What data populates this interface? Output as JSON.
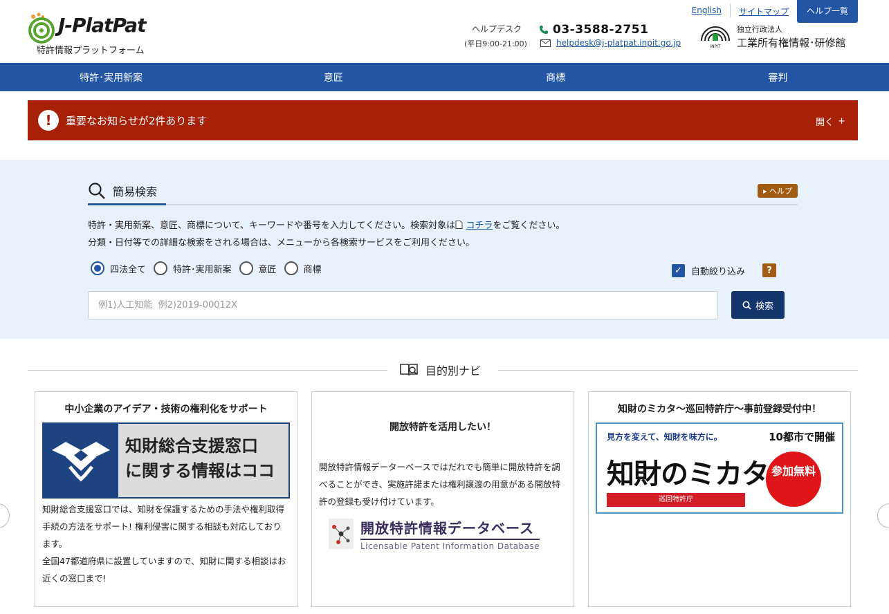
{
  "header": {
    "logo_text": "J-PlatPat",
    "logo_sub": "特許情報プラットフォーム",
    "helpdesk_label": "ヘルプデスク",
    "helpdesk_hours": "(平日9:00-21:00)",
    "phone": "03-3588-2751",
    "email": "helpdesk@j-platpat.inpit.go.jp",
    "top_links": {
      "english": "English",
      "sitemap": "サイトマップ",
      "help_list": "ヘルプ一覧"
    },
    "inpit_line1": "独立行政法人",
    "inpit_line2": "工業所有権情報･研修館",
    "inpit_mark": "INPIT"
  },
  "nav": {
    "items": [
      "特許･実用新案",
      "意匠",
      "商標",
      "審判"
    ]
  },
  "notice": {
    "text": "重要なお知らせが2件あります",
    "open_label": "開く",
    "open_sign": "+",
    "icon": "!"
  },
  "search": {
    "title": "簡易検索",
    "help_label": "ヘルプ",
    "desc1_a": "特許・実用新案、意匠、商標について、キーワードや番号を入力してください。検索対象は",
    "desc1_link": "コチラ",
    "desc1_b": "をご覧ください。",
    "desc2": "分類・日付等での詳細な検索をされる場合は、メニューから各検索サービスをご利用ください。",
    "radios": [
      "四法全て",
      "特許･実用新案",
      "意匠",
      "商標"
    ],
    "selected_radio": "四法全て",
    "auto_label": "自動絞り込み",
    "auto_checked": true,
    "q_mark": "?",
    "placeholder": "例1)人工知能  例2)2019-00012X",
    "button": "検索"
  },
  "navi": {
    "title": "目的別ナビ",
    "cards": [
      {
        "title": "中小企業のアイデア・技術の権利化をサポート",
        "banner_line1": "知財総合支援窓口",
        "banner_line2": "に関する情報はココ",
        "text1": "知財総合支援窓口では、知財を保護するための手法や権利取得手続の方法をサポート! 権利侵害に関する相談も対応しております。",
        "text2": "全国47都道府県に設置していますので、知財に関する相談はお近くの窓口まで!"
      },
      {
        "title": "開放特許を活用したい！",
        "text1": "開放特許情報データーベースではだれでも簡単に開放特許を調べることができ、実施許諾または権利譲渡の用意がある開放特許の登録も受け付けています。",
        "banner_title": "開放特許情報データベース",
        "banner_sub": "Licensable Patent Information Database"
      },
      {
        "title": "知財のミカタ～巡回特許庁～事前登録受付中！",
        "banner_tag": "見方を変えて、知財を味方に。",
        "banner_main": "知財のミカタ",
        "banner_foot": "巡回特許庁",
        "banner_cities": "10都市で開催",
        "banner_free": "参加無料"
      }
    ]
  },
  "colors": {
    "brand_blue": "#2256a5",
    "notice_red": "#a72109",
    "search_bg": "#e8f2fa",
    "help_brown": "#a15c12"
  }
}
